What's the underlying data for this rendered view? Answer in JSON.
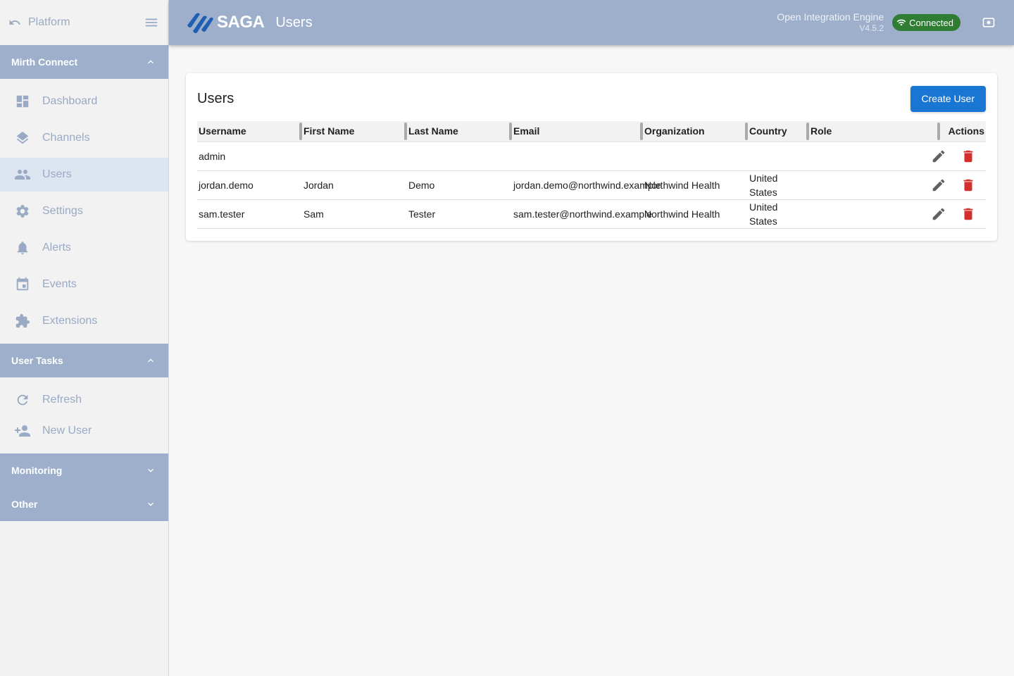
{
  "sidebar": {
    "back_label": "Platform",
    "sections": [
      {
        "title": "Mirth Connect"
      },
      {
        "title": "User Tasks"
      },
      {
        "title": "Monitoring"
      },
      {
        "title": "Other"
      }
    ],
    "nav": [
      {
        "label": "Dashboard",
        "icon": "dashboard-icon"
      },
      {
        "label": "Channels",
        "icon": "layers-icon"
      },
      {
        "label": "Users",
        "icon": "people-icon"
      },
      {
        "label": "Settings",
        "icon": "gear-icon"
      },
      {
        "label": "Alerts",
        "icon": "bell-icon"
      },
      {
        "label": "Events",
        "icon": "calendar-icon"
      },
      {
        "label": "Extensions",
        "icon": "puzzle-icon"
      }
    ],
    "tasks": [
      {
        "label": "Refresh",
        "icon": "refresh-icon"
      },
      {
        "label": "New User",
        "icon": "person-add-icon"
      }
    ]
  },
  "header": {
    "logo_text": "SAGA",
    "title": "Users",
    "engine_name": "Open Integration Engine",
    "engine_version": "V4.5.2",
    "status": "Connected"
  },
  "card": {
    "title": "Users",
    "create_label": "Create User"
  },
  "table": {
    "columns": [
      "Username",
      "First Name",
      "Last Name",
      "Email",
      "Organization",
      "Country",
      "Role",
      "Actions"
    ],
    "rows": [
      {
        "username": "admin",
        "first": "",
        "last": "",
        "email": "",
        "org": "",
        "country": "",
        "role": ""
      },
      {
        "username": "jordan.demo",
        "first": "Jordan",
        "last": "Demo",
        "email": "jordan.demo@northwind.example",
        "org": "Northwind Health",
        "country": "United States",
        "role": ""
      },
      {
        "username": "sam.tester",
        "first": "Sam",
        "last": "Tester",
        "email": "sam.tester@northwind.example",
        "org": "Northwind Health",
        "country": "United States",
        "role": ""
      }
    ]
  },
  "colors": {
    "header": "#9dafcb",
    "primary": "#1976d2",
    "connected": "#2e7d32",
    "delete": "#d32f2f"
  }
}
